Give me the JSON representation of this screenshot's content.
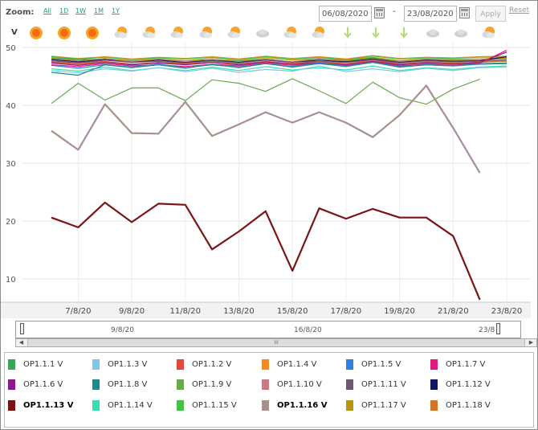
{
  "toolbar": {
    "zoom_label": "Zoom:",
    "zoom_options": [
      "All",
      "1D",
      "1W",
      "1M",
      "1Y"
    ],
    "start_date": "06/08/2020",
    "date_separator": "-",
    "end_date": "23/08/2020",
    "apply_label": "Apply",
    "reset_label": "Reset"
  },
  "weather": {
    "label": "V",
    "icons": [
      "sun-icon",
      "sun-icon",
      "sun-icon",
      "partly-cloudy-icon",
      "partly-cloudy-icon",
      "partly-cloudy-icon",
      "partly-cloudy-icon",
      "partly-cloudy-icon",
      "cloud-icon",
      "partly-cloudy-icon",
      "partly-cloudy-icon",
      "shower-icon",
      "shower-icon",
      "shower-icon",
      "cloud-icon",
      "cloud-icon",
      "partly-cloudy-icon"
    ]
  },
  "navigator": {
    "labels": [
      "9/8/20",
      "16/8/20",
      "23/8"
    ],
    "scroll_grip": "III"
  },
  "chart_data": {
    "type": "line",
    "title": "",
    "xlabel": "",
    "ylabel": "",
    "ylim": [
      5,
      50
    ],
    "yticks": [
      10,
      20,
      30,
      40,
      50
    ],
    "x": [
      "6/8/20",
      "7/8/20",
      "8/8/20",
      "9/8/20",
      "10/8/20",
      "11/8/20",
      "12/8/20",
      "13/8/20",
      "14/8/20",
      "15/8/20",
      "16/8/20",
      "17/8/20",
      "18/8/20",
      "19/8/20",
      "20/8/20",
      "21/8/20",
      "22/8/20",
      "23/8/20"
    ],
    "xtick_labels": [
      "7/8/20",
      "9/8/20",
      "11/8/20",
      "13/8/20",
      "15/8/20",
      "17/8/20",
      "19/8/20",
      "21/8/20",
      "23/8/20"
    ],
    "grid": true,
    "legend_position": "bottom",
    "series": [
      {
        "name": "OP1.1.1 V",
        "color": "#3aa655",
        "values": [
          48.2,
          47.9,
          48.0,
          47.6,
          47.9,
          47.7,
          47.8,
          47.6,
          47.9,
          47.5,
          48.0,
          47.7,
          48.2,
          47.6,
          47.9,
          47.8,
          47.7,
          48.1
        ]
      },
      {
        "name": "OP1.1.3 V",
        "color": "#7ec6ea",
        "values": [
          46.0,
          45.6,
          46.3,
          45.9,
          46.5,
          45.8,
          46.4,
          45.7,
          46.2,
          45.9,
          46.8,
          45.8,
          46.3,
          45.8,
          46.4,
          46.0,
          46.5,
          46.6
        ]
      },
      {
        "name": "OP1.1.2 V",
        "color": "#e2483d",
        "values": [
          47.5,
          47.2,
          47.6,
          47.1,
          47.4,
          47.2,
          47.5,
          47.1,
          47.6,
          47.2,
          47.5,
          47.2,
          47.8,
          47.1,
          47.5,
          47.3,
          47.4,
          47.7
        ]
      },
      {
        "name": "OP1.1.4 V",
        "color": "#f08a24",
        "values": [
          48.5,
          48.1,
          48.4,
          48.0,
          48.3,
          48.1,
          48.4,
          48.0,
          48.5,
          48.1,
          48.4,
          48.0,
          48.6,
          48.1,
          48.3,
          48.2,
          48.4,
          48.5
        ]
      },
      {
        "name": "OP1.1.5 V",
        "color": "#2d7fe0",
        "values": [
          46.9,
          46.4,
          47.0,
          46.6,
          47.1,
          46.5,
          47.0,
          46.6,
          47.2,
          46.7,
          47.3,
          46.8,
          47.4,
          46.7,
          47.0,
          46.8,
          47.1,
          47.2
        ]
      },
      {
        "name": "OP1.1.7 V",
        "color": "#e0197d",
        "values": [
          47.0,
          46.7,
          47.2,
          46.8,
          47.0,
          46.7,
          47.1,
          46.8,
          47.3,
          46.9,
          47.2,
          46.9,
          47.5,
          46.8,
          47.1,
          46.9,
          47.3,
          49.5
        ]
      },
      {
        "name": "OP1.1.6 V",
        "color": "#8b1a8b",
        "values": [
          47.3,
          46.9,
          47.4,
          47.0,
          47.3,
          47.0,
          47.4,
          47.0,
          47.5,
          47.1,
          47.3,
          47.0,
          47.6,
          47.0,
          47.3,
          47.1,
          47.4,
          49.2
        ]
      },
      {
        "name": "OP1.1.8 V",
        "color": "#1e8a8a",
        "values": [
          45.7,
          45.2,
          47.0,
          46.5,
          47.0,
          46.4,
          47.1,
          46.5,
          47.2,
          46.6,
          47.2,
          46.7,
          47.4,
          46.6,
          47.0,
          46.8,
          47.2,
          47.3
        ]
      },
      {
        "name": "OP1.1.9 V",
        "color": "#6aa84f",
        "values": [
          40.3,
          43.8,
          40.9,
          43.0,
          43.0,
          40.8,
          44.4,
          43.8,
          42.4,
          44.6,
          42.5,
          40.3,
          44.0,
          41.3,
          40.2,
          42.8,
          44.5,
          null
        ]
      },
      {
        "name": "OP1.1.10 V",
        "color": "#c97b84",
        "values": [
          48.0,
          47.6,
          48.0,
          47.5,
          47.9,
          47.6,
          47.8,
          47.4,
          47.9,
          47.5,
          48.1,
          47.6,
          48.0,
          47.5,
          47.9,
          47.7,
          47.8,
          48.0
        ]
      },
      {
        "name": "OP1.1.11 V",
        "color": "#6e5a6e",
        "values": [
          47.7,
          47.3,
          47.8,
          47.4,
          47.6,
          47.3,
          47.7,
          47.3,
          47.8,
          47.4,
          47.6,
          47.4,
          47.9,
          47.3,
          47.7,
          47.5,
          47.6,
          47.8
        ]
      },
      {
        "name": "OP1.1.12 V",
        "color": "#141466",
        "values": [
          47.9,
          47.5,
          47.9,
          47.4,
          47.8,
          47.4,
          47.8,
          47.4,
          47.9,
          47.4,
          47.8,
          47.5,
          48.0,
          47.4,
          47.8,
          47.6,
          47.7,
          48.4
        ]
      },
      {
        "name": "OP1.1.13 V",
        "color": "#7a1414",
        "values": [
          20.6,
          18.9,
          23.2,
          19.8,
          23.0,
          22.8,
          15.1,
          18.2,
          21.7,
          11.4,
          22.2,
          20.4,
          22.1,
          20.6,
          20.6,
          17.4,
          6.4,
          null
        ]
      },
      {
        "name": "OP1.1.14 V",
        "color": "#33e0b0",
        "values": [
          46.3,
          45.9,
          46.6,
          46.0,
          46.5,
          46.0,
          46.6,
          46.0,
          46.7,
          46.1,
          46.5,
          46.1,
          46.8,
          46.0,
          46.5,
          46.2,
          46.6,
          46.8
        ]
      },
      {
        "name": "OP1.1.15 V",
        "color": "#48c048",
        "values": [
          48.4,
          48.0,
          48.3,
          47.9,
          48.2,
          48.0,
          48.3,
          47.9,
          48.4,
          48.0,
          48.3,
          47.9,
          48.5,
          48.0,
          48.2,
          48.1,
          48.3,
          48.3
        ]
      },
      {
        "name": "OP1.1.16 V",
        "color": "#a8908c",
        "values": [
          35.6,
          32.3,
          40.2,
          35.2,
          35.1,
          40.6,
          34.7,
          36.7,
          38.8,
          37.0,
          38.8,
          37.0,
          34.5,
          38.3,
          43.4,
          36.1,
          28.3,
          null
        ]
      },
      {
        "name": "OP1.1.17 V",
        "color": "#b8960c",
        "values": [
          48.1,
          47.7,
          48.1,
          47.7,
          48.0,
          47.7,
          48.1,
          47.7,
          48.2,
          47.8,
          48.1,
          47.8,
          48.3,
          47.7,
          48.0,
          47.9,
          48.0,
          48.2
        ]
      },
      {
        "name": "OP1.1.18 V",
        "color": "#d27428",
        "values": [
          47.4,
          47.0,
          47.5,
          47.0,
          47.4,
          47.1,
          47.5,
          47.0,
          47.6,
          47.1,
          47.4,
          47.1,
          47.7,
          47.0,
          47.4,
          47.2,
          47.5,
          47.6
        ]
      }
    ]
  }
}
